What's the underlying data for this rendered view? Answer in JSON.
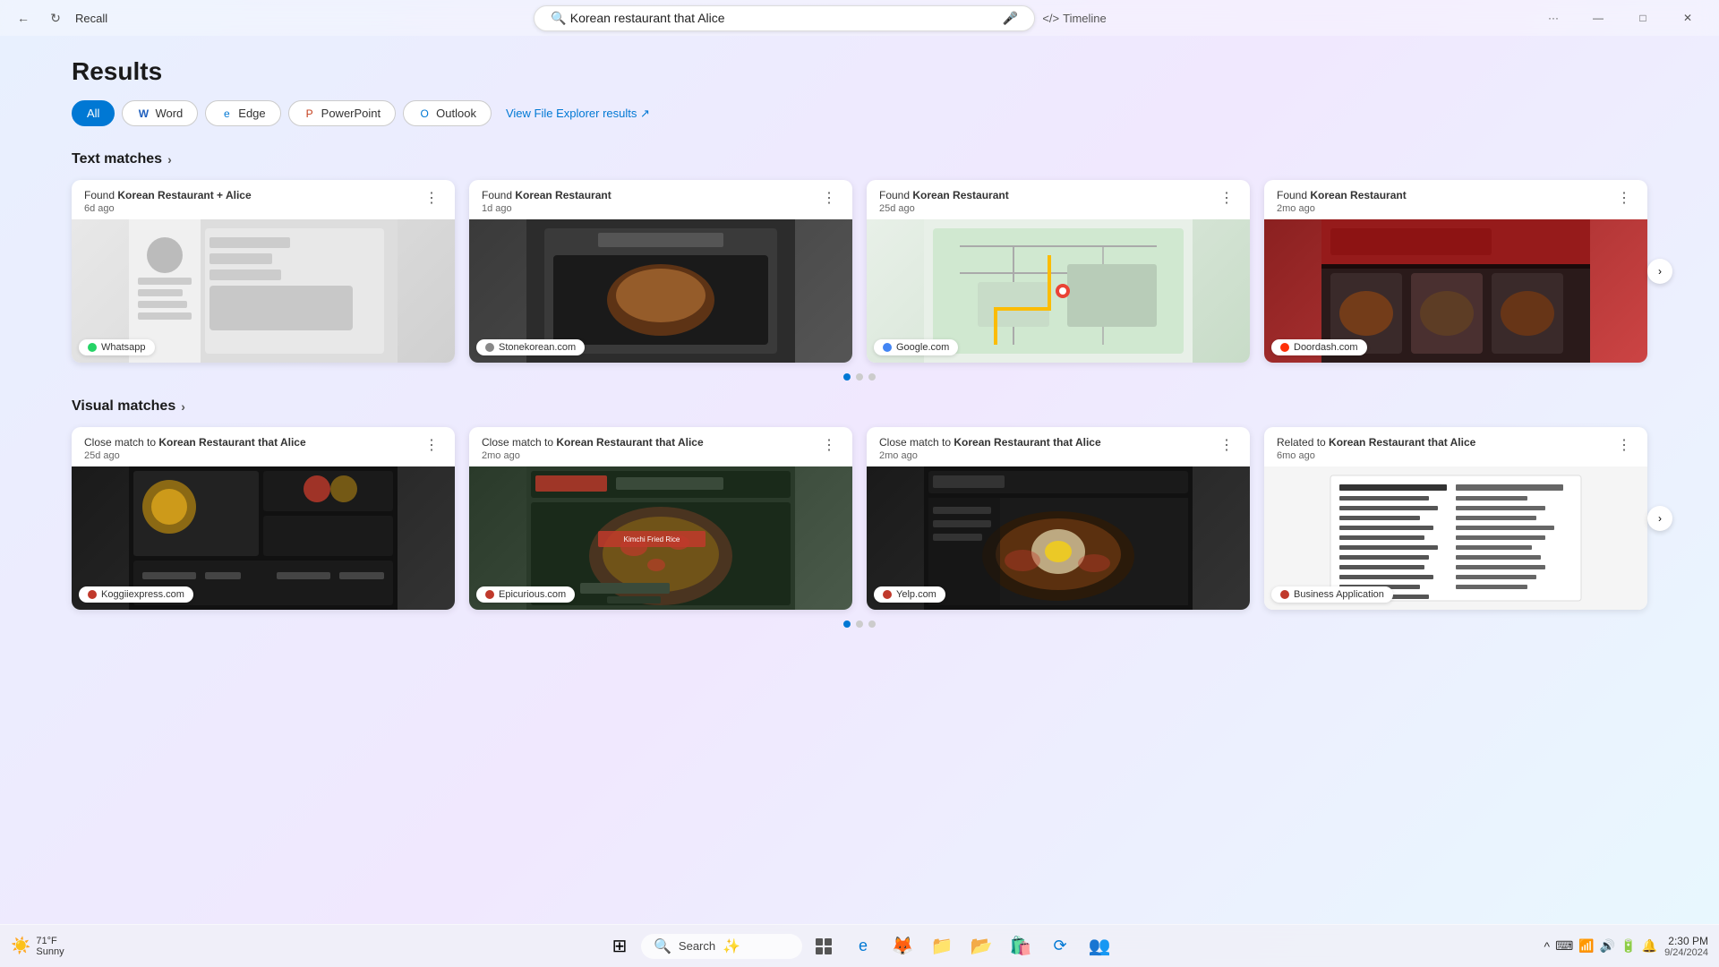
{
  "titlebar": {
    "app_name": "Recall",
    "search_value": "Korean restaurant that Alice",
    "search_placeholder": "Korean restaurant that Alice",
    "mic_icon": "🎤",
    "timeline_label": "Timeline",
    "more_icon": "···",
    "minimize_icon": "—",
    "maximize_icon": "□",
    "close_icon": "✕"
  },
  "page": {
    "title": "Results"
  },
  "filters": [
    {
      "id": "all",
      "label": "All",
      "active": true,
      "icon": ""
    },
    {
      "id": "word",
      "label": "Word",
      "active": false,
      "icon": "W"
    },
    {
      "id": "edge",
      "label": "Edge",
      "active": false,
      "icon": "e"
    },
    {
      "id": "powerpoint",
      "label": "PowerPoint",
      "active": false,
      "icon": "P"
    },
    {
      "id": "outlook",
      "label": "Outlook",
      "active": false,
      "icon": "O"
    }
  ],
  "view_file_link": "View File Explorer results ↗",
  "text_matches": {
    "section_title": "Text matches",
    "chevron": "›",
    "cards": [
      {
        "found_prefix": "Found ",
        "found_bold": "Korean Restaurant + Alice",
        "time": "6d ago",
        "source": "Whatsapp",
        "source_color": "green",
        "image_type": "whatsapp"
      },
      {
        "found_prefix": "Found ",
        "found_bold": "Korean Restaurant",
        "time": "1d ago",
        "source": "Stonekorean.com",
        "source_color": "gray",
        "image_type": "stone"
      },
      {
        "found_prefix": "Found ",
        "found_bold": "Korean Restaurant",
        "time": "25d ago",
        "source": "Google.com",
        "source_color": "map",
        "image_type": "google"
      },
      {
        "found_prefix": "Found ",
        "found_bold": "Korean Restaurant",
        "time": "2mo ago",
        "source": "Doordash.com",
        "source_color": "red",
        "image_type": "doordash"
      }
    ],
    "pagination": [
      true,
      false,
      false
    ]
  },
  "visual_matches": {
    "section_title": "Visual matches",
    "chevron": "›",
    "cards": [
      {
        "found_prefix": "Close match to ",
        "found_bold": "Korean Restaurant that Alice",
        "time": "25d ago",
        "source": "Koggiiexpress.com",
        "source_color": "koggi",
        "image_type": "koggi"
      },
      {
        "found_prefix": "Close match to ",
        "found_bold": "Korean Restaurant that Alice",
        "time": "2mo ago",
        "source": "Epicurious.com",
        "source_color": "epi",
        "image_type": "epi"
      },
      {
        "found_prefix": "Close match to ",
        "found_bold": "Korean Restaurant that Alice",
        "time": "2mo ago",
        "source": "Yelp.com",
        "source_color": "yelp",
        "image_type": "yelp"
      },
      {
        "found_prefix": "Related to ",
        "found_bold": "Korean Restaurant that Alice",
        "time": "6mo ago",
        "source": "Business Application",
        "source_color": "business",
        "image_type": "business"
      }
    ],
    "pagination": [
      true,
      false,
      false
    ]
  },
  "taskbar": {
    "weather_icon": "☀️",
    "weather_temp": "71°F",
    "weather_desc": "Sunny",
    "search_label": "Search",
    "clock_time": "2:30 PM",
    "clock_date": "9/24/2024"
  }
}
